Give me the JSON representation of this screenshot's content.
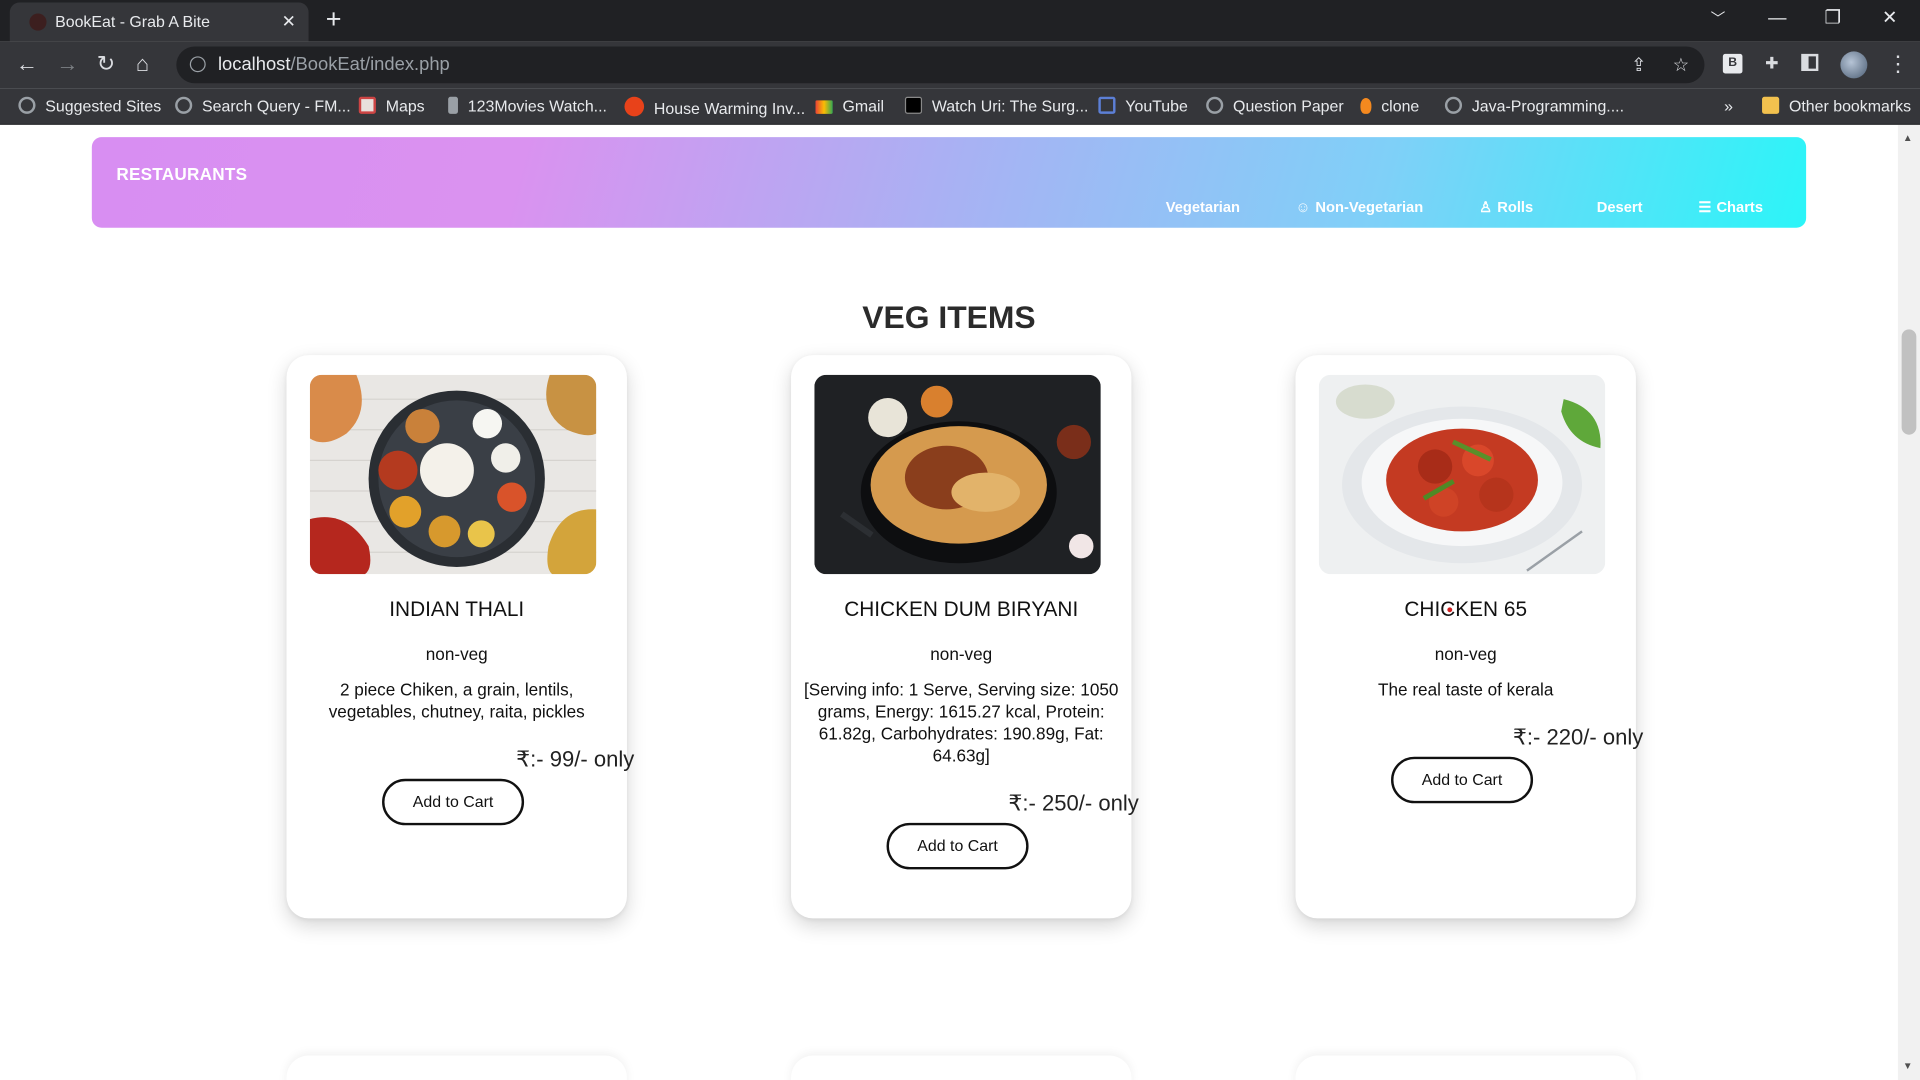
{
  "browser": {
    "tab_title": "BookEat - Grab A Bite",
    "url_host": "localhost",
    "url_path": "/BookEat/index.php",
    "bookmarks": [
      {
        "label": "Suggested Sites",
        "icon": "globe-icon"
      },
      {
        "label": "Search Query - FM...",
        "icon": "globe-icon"
      },
      {
        "label": "Maps",
        "icon": "maps-icon"
      },
      {
        "label": "123Movies Watch...",
        "icon": "movie-icon"
      },
      {
        "label": "House Warming Inv...",
        "icon": "up-icon"
      },
      {
        "label": "Gmail",
        "icon": "gmail-icon"
      },
      {
        "label": "Watch Uri: The Surg...",
        "icon": "d-icon"
      },
      {
        "label": "YouTube",
        "icon": "youtube-icon"
      },
      {
        "label": "Question Paper",
        "icon": "globe-icon"
      },
      {
        "label": "clone",
        "icon": "flame-icon"
      },
      {
        "label": "Java-Programming....",
        "icon": "globe-icon"
      }
    ],
    "overflow_label": "»",
    "other_bookmarks": "Other bookmarks"
  },
  "navbar": {
    "brand": "RESTAURANTS",
    "links": [
      {
        "label": "Vegetarian",
        "icon": ""
      },
      {
        "label": "Non-Vegetarian",
        "icon": "☺"
      },
      {
        "label": "Rolls",
        "icon": "♙"
      },
      {
        "label": "Desert",
        "icon": ""
      },
      {
        "label": "Charts",
        "icon": "☰"
      }
    ]
  },
  "section": {
    "title": "VEG ITEMS"
  },
  "cards": [
    {
      "title": "INDIAN THALI",
      "type": "non-veg",
      "description": "2 piece Chiken, a grain, lentils, vegetables, chutney, raita, pickles",
      "price": "₹:- 99/- only",
      "button": "Add to Cart"
    },
    {
      "title": "CHICKEN DUM BIRYANI",
      "type": "non-veg",
      "description": "[Serving info: 1 Serve, Serving size: 1050 grams, Energy: 1615.27 kcal, Protein: 61.82g, Carbohydrates: 190.89g, Fat: 64.63g]",
      "price": "₹:- 250/- only",
      "button": "Add to Cart"
    },
    {
      "title": "CHICKEN 65",
      "type": "non-veg",
      "description": "The real taste of kerala",
      "price": "₹:- 220/- only",
      "button": "Add to Cart"
    }
  ],
  "colors": {
    "navbar_gradient_start": "#d88ef2",
    "navbar_gradient_end": "#2bf5f8",
    "chrome_dark": "#202124",
    "chrome_mid": "#35363a"
  }
}
